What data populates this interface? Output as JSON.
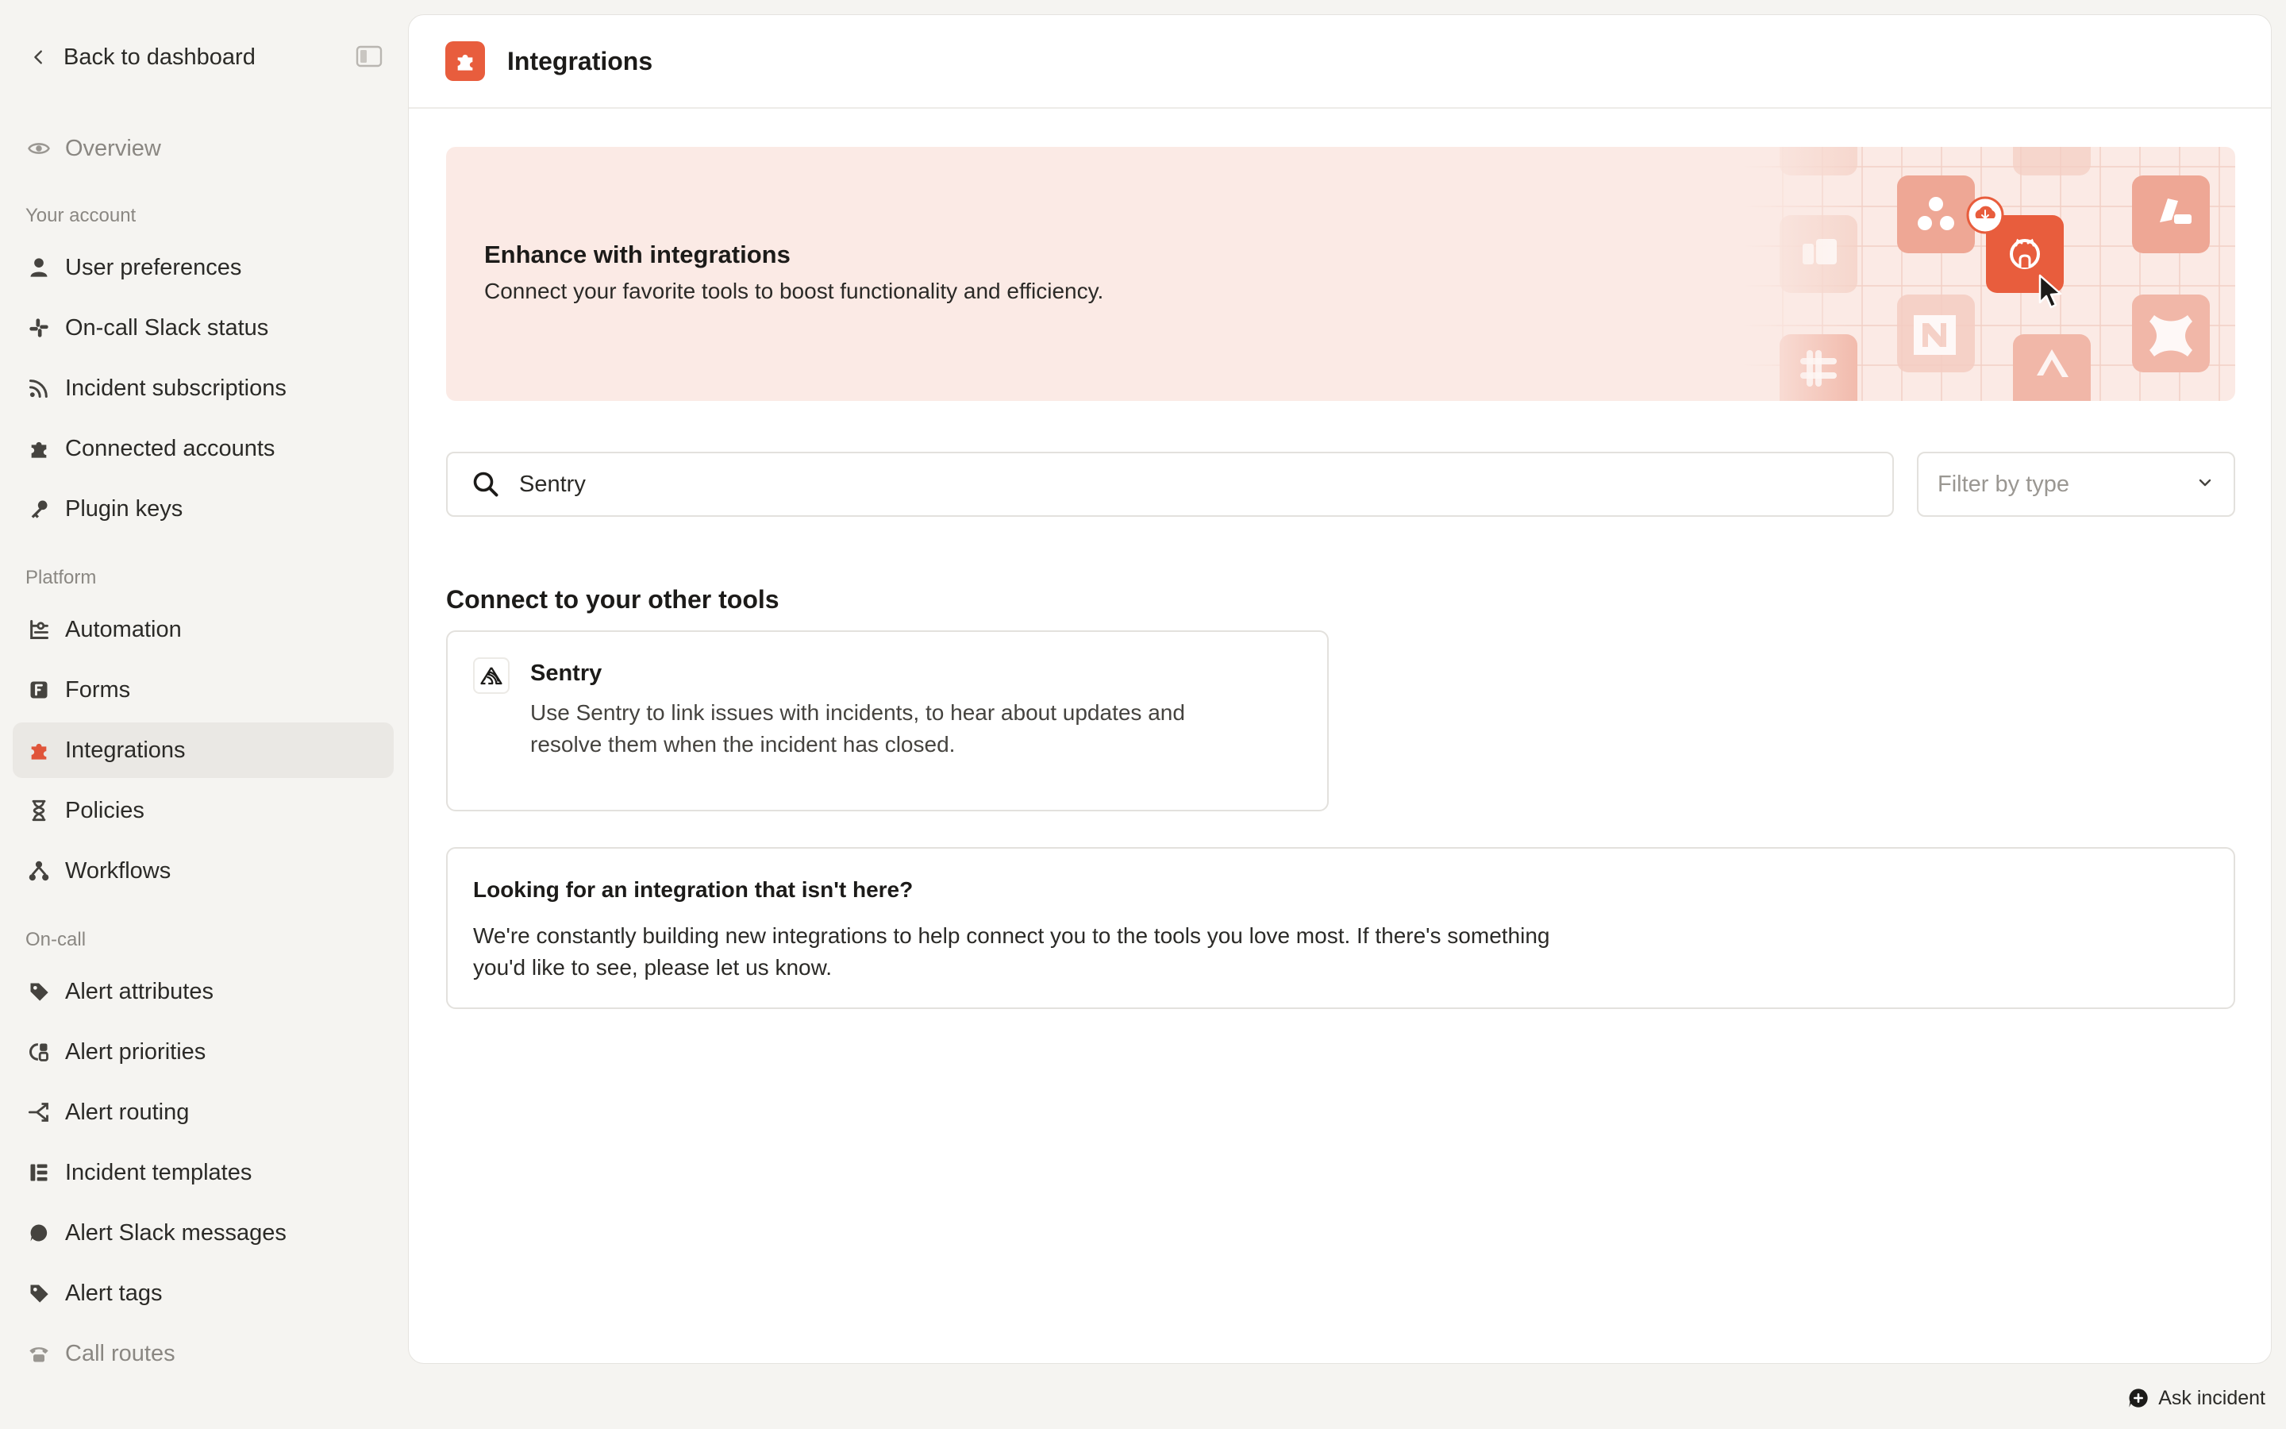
{
  "sidebar": {
    "back_label": "Back to dashboard",
    "overview": "Overview",
    "sections": {
      "account": "Your account",
      "platform": "Platform",
      "oncall": "On-call"
    },
    "account_items": [
      {
        "label": "User preferences",
        "icon": "user-icon"
      },
      {
        "label": "On-call Slack status",
        "icon": "slack-icon"
      },
      {
        "label": "Incident subscriptions",
        "icon": "rss-icon"
      },
      {
        "label": "Connected accounts",
        "icon": "puzzle-icon"
      },
      {
        "label": "Plugin keys",
        "icon": "key-icon"
      }
    ],
    "platform_items": [
      {
        "label": "Automation",
        "icon": "automation-icon"
      },
      {
        "label": "Forms",
        "icon": "form-icon"
      },
      {
        "label": "Integrations",
        "icon": "puzzle-icon"
      },
      {
        "label": "Policies",
        "icon": "hourglass-icon"
      },
      {
        "label": "Workflows",
        "icon": "workflow-icon"
      }
    ],
    "oncall_items": [
      {
        "label": "Alert attributes",
        "icon": "tag-icon"
      },
      {
        "label": "Alert priorities",
        "icon": "priority-icon"
      },
      {
        "label": "Alert routing",
        "icon": "routing-icon"
      },
      {
        "label": "Incident templates",
        "icon": "template-icon"
      },
      {
        "label": "Alert Slack messages",
        "icon": "message-icon"
      },
      {
        "label": "Alert tags",
        "icon": "tag-icon"
      },
      {
        "label": "Call routes",
        "icon": "phone-icon"
      }
    ]
  },
  "header": {
    "title": "Integrations"
  },
  "banner": {
    "title": "Enhance with integrations",
    "subtitle": "Connect your favorite tools to boost functionality and efficiency."
  },
  "search": {
    "value": "Sentry"
  },
  "filter": {
    "placeholder": "Filter by type"
  },
  "results": {
    "section_title": "Connect to your other tools",
    "items": [
      {
        "name": "Sentry",
        "description": "Use Sentry to link issues with incidents, to hear about updates and resolve them when the incident has closed."
      }
    ]
  },
  "notice": {
    "title": "Looking for an integration that isn't here?",
    "body": "We're constantly building new integrations to help connect you to the tools you love most. If there's something you'd like to see, please let us know."
  },
  "footer": {
    "ask_label": "Ask incident"
  },
  "colors": {
    "accent": "#e85d3d",
    "banner_bg": "#fbeae5",
    "sidebar_bg": "#f5f4f1",
    "active_item_bg": "#eae8e4"
  }
}
